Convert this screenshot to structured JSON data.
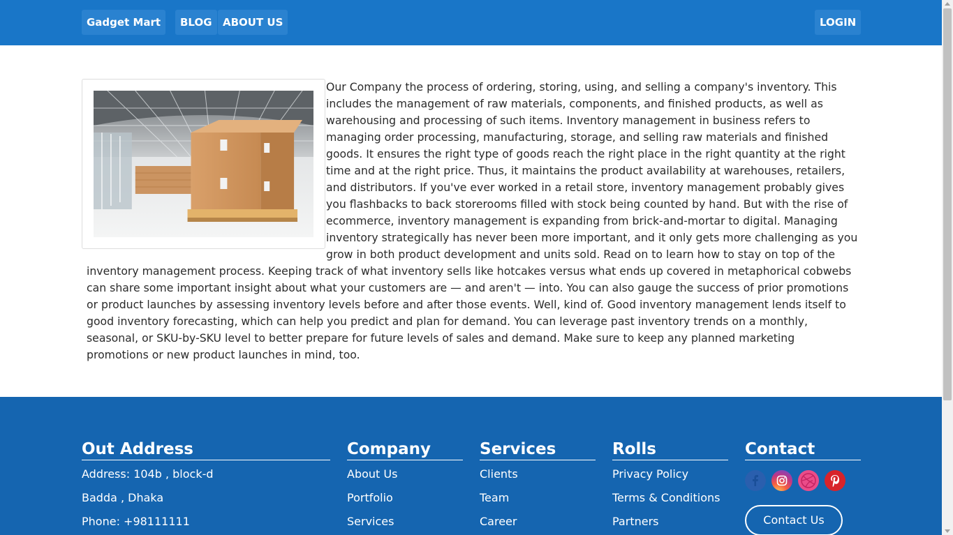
{
  "navbar": {
    "brand": "Gadget Mart",
    "blog": "BLOG",
    "about": "ABOUT US",
    "login": "LOGIN",
    "bg_color": "#1976c8"
  },
  "article": {
    "image_alt": "warehouse with stacked cardboard boxes on pallet",
    "text": "Our Company the process of ordering, storing, using, and selling a company's inventory. This includes the management of raw materials, components, and finished products, as well as warehousing and processing of such items. Inventory management in business refers to managing order processing, manufacturing, storage, and selling raw materials and finished goods. It ensures the right type of goods reach the right place in the right quantity at the right time and at the right price. Thus, it maintains the product availability at warehouses, retailers, and distributors. If you've ever worked in a retail store, inventory management probably gives you flashbacks to back storerooms filled with stock being counted by hand. But with the rise of ecommerce, inventory management is expanding from brick-and-mortar to digital. Managing inventory strategically has never been more important, and it only gets more challenging as you grow in both product development and units sold. Read on to learn how to stay on top of the inventory management process. Keeping track of what inventory sells like hotcakes versus what ends up covered in metaphorical cobwebs can share some important insight about what your customers are — and aren't — into. You can also gauge the success of prior promotions or product launches by assessing inventory levels before and after those events. Well, kind of. Good inventory management lends itself to good inventory forecasting, which can help you predict and plan for demand. You can leverage past inventory trends on a monthly, seasonal, or SKU-by-SKU level to better prepare for future levels of sales and demand. Make sure to keep any planned marketing promotions or new product launches in mind, too."
  },
  "footer": {
    "bg_color": "#1565b0",
    "address": {
      "title": "Out Address",
      "items": [
        "Address: 104b , block-d",
        "Badda , Dhaka",
        "Phone: +98111111"
      ]
    },
    "company": {
      "title": "Company",
      "items": [
        "About Us",
        "Portfolio",
        "Services"
      ]
    },
    "services": {
      "title": "Services",
      "items": [
        "Clients",
        "Team",
        "Career"
      ]
    },
    "rolls": {
      "title": "Rolls",
      "items": [
        "Privacy Policy",
        "Terms & Conditions",
        "Partners"
      ]
    },
    "contact": {
      "title": "Contact",
      "social_icons": [
        "facebook-icon",
        "instagram-icon",
        "dribbble-icon",
        "pinterest-icon"
      ],
      "button": "Contact Us"
    }
  }
}
